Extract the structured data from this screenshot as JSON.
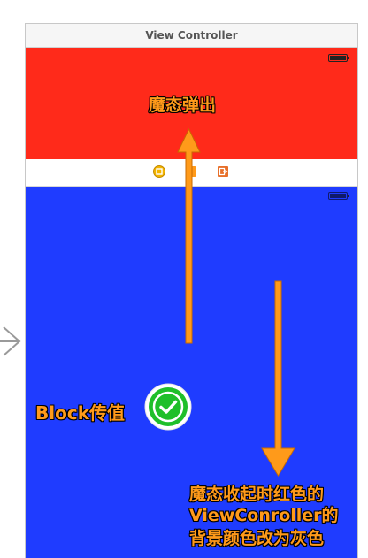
{
  "window": {
    "title": "View Controller"
  },
  "annotations": {
    "modal_present": "魔态弹出",
    "block_pass": "Block传值",
    "dismiss_line1": "魔态收起时红色的",
    "dismiss_line2": "ViewConroller的",
    "dismiss_line3": "背景颜色改为灰色"
  },
  "colors": {
    "red_view": "#ff2a1a",
    "blue_view": "#1f3cff",
    "annotation_orange": "#ff9a1a",
    "check_green": "#1fbf2a"
  },
  "icons": {
    "dock": [
      "view-controller-icon",
      "first-responder-icon",
      "exit-icon"
    ],
    "entry": "entry-arrow-icon",
    "check": "check-circle-icon"
  }
}
